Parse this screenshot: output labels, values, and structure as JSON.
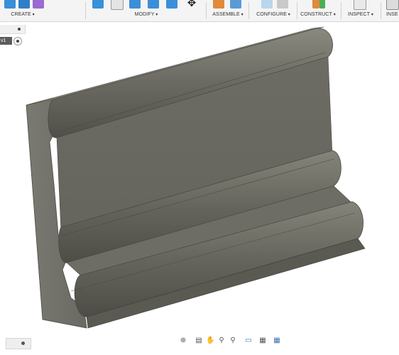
{
  "toolbar": {
    "groups": [
      {
        "label": "CREATE"
      },
      {
        "label": "MODIFY"
      },
      {
        "label": "ASSEMBLE"
      },
      {
        "label": "CONFIGURE"
      },
      {
        "label": "CONSTRUCT"
      },
      {
        "label": "INSPECT"
      },
      {
        "label": "INSE"
      }
    ]
  },
  "browser": {
    "component_tag": "v1"
  },
  "colors": {
    "toolbar_bg": "#f4f4f4",
    "model_face": "#6b6a62",
    "model_edge": "#4a4943",
    "accent_blue": "#3a8fd9"
  },
  "icons": {
    "navbar": [
      "orbit-icon",
      "look-at-icon",
      "pan-icon",
      "zoom-icon",
      "zoom-window-icon",
      "display-settings-icon",
      "grid-settings-icon",
      "viewports-icon"
    ]
  }
}
